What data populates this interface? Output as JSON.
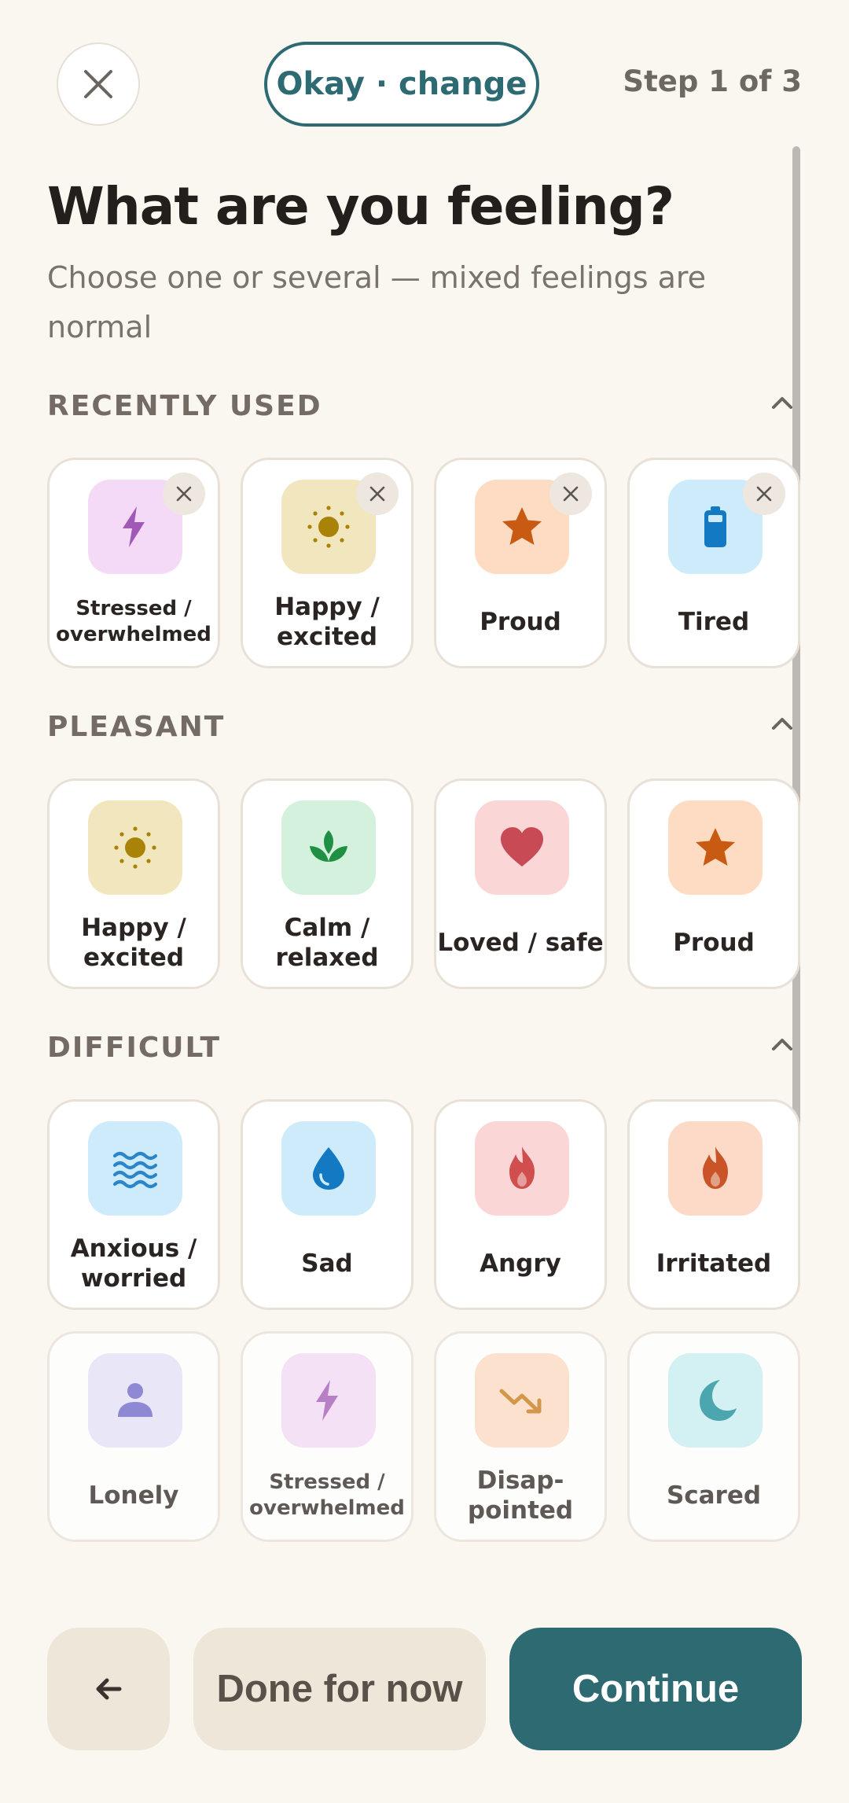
{
  "header": {
    "close_icon": "close-icon",
    "status_pill": "Okay · change",
    "step_label": "Step 1 of 3"
  },
  "title": "What are you feeling?",
  "subtitle": "Choose one or several — mixed feelings are normal",
  "sections": {
    "recent": {
      "label": "RECENTLY USED",
      "items": [
        {
          "label": "Stressed / overwhelmed",
          "icon": "lightning-icon",
          "tile_color": "#F4DAF7",
          "icon_color": "#A159B8"
        },
        {
          "label": "Happy / excited",
          "icon": "sun-icon",
          "tile_color": "#F1E6BD",
          "icon_color": "#A88308"
        },
        {
          "label": "Proud",
          "icon": "star-icon",
          "tile_color": "#FDDCC3",
          "icon_color": "#C95A12"
        },
        {
          "label": "Tired",
          "icon": "battery-icon",
          "tile_color": "#CDEBFA",
          "icon_color": "#1279C2"
        }
      ]
    },
    "pleasant": {
      "label": "PLEASANT",
      "items": [
        {
          "label": "Happy / excited",
          "icon": "sun-icon",
          "tile_color": "#F1E6BD",
          "icon_color": "#A88308"
        },
        {
          "label": "Calm / relaxed",
          "icon": "leaf-icon",
          "tile_color": "#D3F1DC",
          "icon_color": "#1E8F43"
        },
        {
          "label": "Loved / safe",
          "icon": "heart-icon",
          "tile_color": "#FBD6D7",
          "icon_color": "#C84A55"
        },
        {
          "label": "Proud",
          "icon": "star-icon",
          "tile_color": "#FDDCC3",
          "icon_color": "#C95A12"
        }
      ]
    },
    "difficult": {
      "label": "DIFFICULT",
      "items": [
        {
          "label": "Anxious / worried",
          "icon": "waves-icon",
          "tile_color": "#CDEBFA",
          "icon_color": "#2B86C9"
        },
        {
          "label": "Sad",
          "icon": "droplet-icon",
          "tile_color": "#CDEBFA",
          "icon_color": "#1279C2"
        },
        {
          "label": "Angry",
          "icon": "flame-icon",
          "tile_color": "#FBD6D7",
          "icon_color": "#D04E4E"
        },
        {
          "label": "Irritated",
          "icon": "flame-icon",
          "tile_color": "#FDDAC8",
          "icon_color": "#C95428"
        },
        {
          "label": "Lonely",
          "icon": "person-icon",
          "tile_color": "#E2E1FA",
          "icon_color": "#6A65C8"
        },
        {
          "label": "Stressed / overwhelmed",
          "icon": "lightning-icon",
          "tile_color": "#F4DAF7",
          "icon_color": "#A159B8"
        },
        {
          "label": "Disap-pointed",
          "icon": "trend-down-icon",
          "tile_color": "#FDDCC3",
          "icon_color": "#C77814"
        },
        {
          "label": "Scared",
          "icon": "moon-icon",
          "tile_color": "#C6EEF3",
          "icon_color": "#138C9A"
        }
      ]
    }
  },
  "footer": {
    "back_icon": "arrow-left-icon",
    "done_label": "Done for now",
    "continue_label": "Continue"
  }
}
